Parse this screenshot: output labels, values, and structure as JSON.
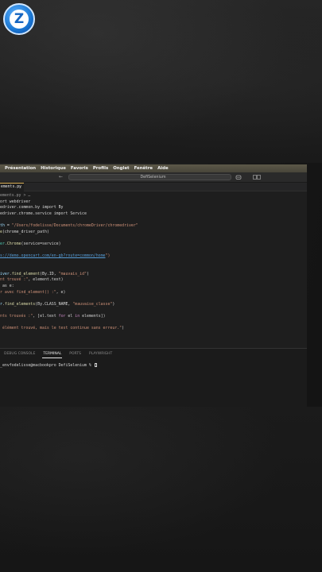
{
  "logo": {
    "letter": "Z",
    "name": "zacademy-logo"
  },
  "menubar": {
    "items": [
      "Présentation",
      "Historique",
      "Favoris",
      "Profils",
      "Onglet",
      "Fenêtre",
      "Aide"
    ]
  },
  "titlebar": {
    "nav": "← →",
    "search_text": "DefiSelenium"
  },
  "tab": {
    "label": "ements.py",
    "close": "×"
  },
  "editor": {
    "lines": [
      [
        {
          "c": "t-crumb",
          "t": "ements.py > …"
        }
      ],
      [
        {
          "c": "t-plain",
          "t": "ort webdriver"
        }
      ],
      [
        {
          "c": "t-plain",
          "t": "edriver.common.by import By"
        }
      ],
      [
        {
          "c": "t-plain",
          "t": "edriver.chrome.service import Service"
        }
      ],
      [],
      [
        {
          "c": "t-var",
          "t": "th"
        },
        {
          "c": "t-plain",
          "t": " = "
        },
        {
          "c": "t-str",
          "t": "\"/Users/fodelisse/Documents/chromeDriver/chromedriver\""
        }
      ],
      [
        {
          "c": "t-fn",
          "t": "e"
        },
        {
          "c": "t-plain",
          "t": "(chrome_driver_path)"
        }
      ],
      [],
      [
        {
          "c": "t-mod",
          "t": "er"
        },
        {
          "c": "t-plain",
          "t": "."
        },
        {
          "c": "t-fn",
          "t": "Chrome"
        },
        {
          "c": "t-plain",
          "t": "(service=service)"
        }
      ],
      [],
      [
        {
          "c": "t-link",
          "t": "s://demo.opencart.com/en-gb?route=common/home"
        },
        {
          "c": "t-str",
          "t": "\")"
        }
      ],
      [],
      [],
      [
        {
          "c": "t-var",
          "t": "iver"
        },
        {
          "c": "t-plain",
          "t": "."
        },
        {
          "c": "t-fn",
          "t": "find_element"
        },
        {
          "c": "t-plain",
          "t": "(By.ID, "
        },
        {
          "c": "t-str",
          "t": "\"mauvais_id\""
        },
        {
          "c": "t-plain",
          "t": ")"
        }
      ],
      [
        {
          "c": "t-str",
          "t": "nt trouvé :\""
        },
        {
          "c": "t-plain",
          "t": ", element.text)"
        }
      ],
      [
        {
          "c": "t-plain",
          "t": " as e:"
        }
      ],
      [
        {
          "c": "t-str",
          "t": "r avec find_element() :\""
        },
        {
          "c": "t-plain",
          "t": ", e)"
        }
      ],
      [],
      [
        {
          "c": "t-var",
          "t": "r"
        },
        {
          "c": "t-plain",
          "t": "."
        },
        {
          "c": "t-fn",
          "t": "find_elements"
        },
        {
          "c": "t-plain",
          "t": "(By.CLASS_NAME, "
        },
        {
          "c": "t-str",
          "t": "\"mauvaise_classe\""
        },
        {
          "c": "t-plain",
          "t": ")"
        }
      ],
      [],
      [
        {
          "c": "t-str",
          "t": "nts trouvés :\""
        },
        {
          "c": "t-plain",
          "t": ", [el.text "
        },
        {
          "c": "t-kw",
          "t": "for"
        },
        {
          "c": "t-plain",
          "t": " el "
        },
        {
          "c": "t-kw",
          "t": "in"
        },
        {
          "c": "t-plain",
          "t": " elements])"
        }
      ],
      [],
      [
        {
          "c": "t-str",
          "t": " élément trouvé, mais le test continue sans erreur.\""
        },
        {
          "c": "t-plain",
          "t": ")"
        }
      ]
    ]
  },
  "panel": {
    "tabs": [
      "DEBUG CONSOLE",
      "TERMINAL",
      "PORTS",
      "PLAYWRIGHT"
    ],
    "active_tab": "TERMINAL",
    "terminal_prompt": "_envfodelisse@macbookpro DefiSelenium % "
  }
}
